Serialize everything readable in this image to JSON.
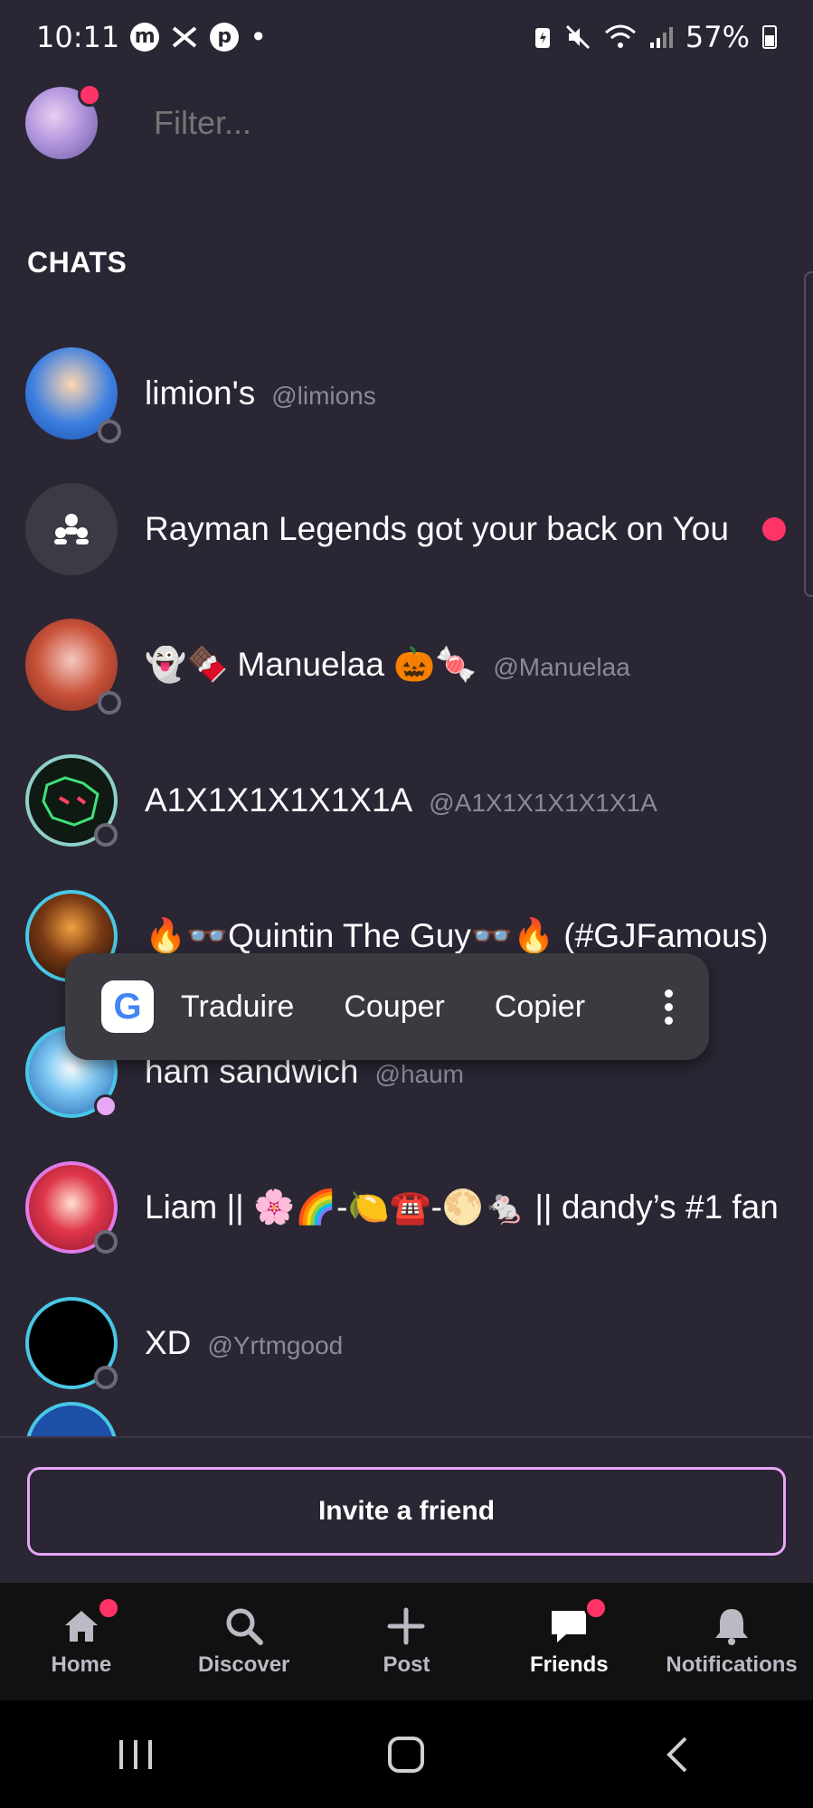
{
  "status_bar": {
    "time": "10:11",
    "app_icons": [
      "messenger-icon",
      "x-icon",
      "pinterest-icon"
    ],
    "dot": "•",
    "battery": "57%"
  },
  "header": {
    "filter_placeholder": "Filter..."
  },
  "section": {
    "title": "CHATS"
  },
  "chats": [
    {
      "name": "limion's",
      "handle": "@limions",
      "status": "offline"
    },
    {
      "name": "Rayman Legends got your back on You",
      "handle": "",
      "unread": true,
      "group": true
    },
    {
      "name": "👻🍫 Manuelaa 🎃🍬",
      "handle": "@Manuelaa",
      "status": "offline"
    },
    {
      "name": "A1X1X1X1X1X1A",
      "handle": "@A1X1X1X1X1X1A",
      "status": "offline"
    },
    {
      "name": "🔥👓Quintin The Guy👓🔥 (#GJFamous)",
      "handle": "",
      "status": "offline"
    },
    {
      "name": "ham sandwich",
      "handle": "@haum",
      "status": "online"
    },
    {
      "name": "Liam || 🌸🌈-🍋☎️-🌕🐁 || dandy’s #1 fan",
      "handle": "",
      "status": "offline"
    },
    {
      "name": "XD",
      "handle": "@Yrtmgood",
      "status": "offline"
    }
  ],
  "context_menu": {
    "items": [
      "Traduire",
      "Couper",
      "Copier"
    ]
  },
  "invite": {
    "label": "Invite a friend"
  },
  "bottom_nav": {
    "items": [
      {
        "label": "Home",
        "icon": "home-icon",
        "badge": true
      },
      {
        "label": "Discover",
        "icon": "search-icon",
        "badge": false
      },
      {
        "label": "Post",
        "icon": "plus-icon",
        "badge": false
      },
      {
        "label": "Friends",
        "icon": "chat-icon",
        "badge": true,
        "active": true
      },
      {
        "label": "Notifications",
        "icon": "bell-icon",
        "badge": false
      }
    ]
  },
  "colors": {
    "background": "#2a2634",
    "accent": "#ff3366",
    "invite_border": "#e5a6f5",
    "nav_bg": "#111111"
  }
}
